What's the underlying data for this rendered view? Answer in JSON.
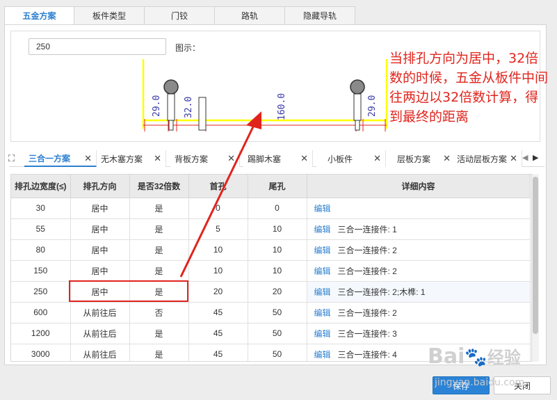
{
  "top_tabs": [
    "五金方案",
    "板件类型",
    "门铰",
    "路轨",
    "隐藏导轨"
  ],
  "preview": {
    "width_value": "250",
    "figure_label": "图示：",
    "dims": [
      "29.0",
      "32.0",
      "160.0",
      "29.0"
    ]
  },
  "annotation": "当排孔方向为居中，32倍数的时候，五金从板件中间往两边以32倍数计算，得到最终的距离",
  "sub_tabs": [
    "三合一方案",
    "无木塞方案",
    "背板方案",
    "踢脚木塞",
    "小板件",
    "层板方案",
    "活动层板方案"
  ],
  "grid": {
    "columns": [
      "排孔边宽度(≤)",
      "排孔方向",
      "是否32倍数",
      "首孔",
      "尾孔",
      "详细内容"
    ],
    "edit_label": "编辑",
    "rows": [
      {
        "w": "30",
        "dir": "居中",
        "m32": "是",
        "first": "0",
        "last": "0",
        "detail": ""
      },
      {
        "w": "55",
        "dir": "居中",
        "m32": "是",
        "first": "5",
        "last": "10",
        "detail": "三合一连接件: 1"
      },
      {
        "w": "80",
        "dir": "居中",
        "m32": "是",
        "first": "10",
        "last": "10",
        "detail": "三合一连接件: 2"
      },
      {
        "w": "150",
        "dir": "居中",
        "m32": "是",
        "first": "10",
        "last": "10",
        "detail": "三合一连接件: 2"
      },
      {
        "w": "250",
        "dir": "居中",
        "m32": "是",
        "first": "20",
        "last": "20",
        "detail": "三合一连接件: 2;木榫: 1"
      },
      {
        "w": "600",
        "dir": "从前往后",
        "m32": "否",
        "first": "45",
        "last": "50",
        "detail": "三合一连接件: 2"
      },
      {
        "w": "1200",
        "dir": "从前往后",
        "m32": "是",
        "first": "45",
        "last": "50",
        "detail": "三合一连接件: 3"
      },
      {
        "w": "3000",
        "dir": "从前往后",
        "m32": "是",
        "first": "45",
        "last": "50",
        "detail": "三合一连接件: 4"
      }
    ]
  },
  "footer": {
    "ok": "保存",
    "close": "关闭"
  },
  "watermark": {
    "brand": "Bai",
    "cn": "经验",
    "url": "jingyan.baidu.com"
  },
  "colors": {
    "accent": "#2b7fd0",
    "annotation": "#e0241c",
    "board_edge": "#ffff00",
    "dim_text": "#3a3aa8"
  }
}
